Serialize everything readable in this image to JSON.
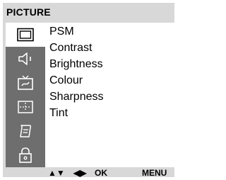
{
  "menu": {
    "title": "PICTURE",
    "items": [
      {
        "label": "PSM"
      },
      {
        "label": "Contrast"
      },
      {
        "label": "Brightness"
      },
      {
        "label": "Colour"
      },
      {
        "label": "Sharpness"
      },
      {
        "label": "Tint"
      }
    ]
  },
  "sidebar": {
    "icons": [
      {
        "name": "picture-icon",
        "active": true
      },
      {
        "name": "sound-icon",
        "active": false
      },
      {
        "name": "tv-channel-icon",
        "active": false
      },
      {
        "name": "screen-icon",
        "active": false
      },
      {
        "name": "special-icon",
        "active": false
      },
      {
        "name": "lock-icon",
        "active": false
      }
    ]
  },
  "footer": {
    "updown_label": "▲▼",
    "leftright_label": "◀▶",
    "ok_label": "OK",
    "menu_label": "MENU"
  },
  "colors": {
    "osd_background": "#d8d8d8",
    "icon_column": "#6e6e6e",
    "active_icon": "#ffffff",
    "menu_panel": "#ffffff"
  }
}
